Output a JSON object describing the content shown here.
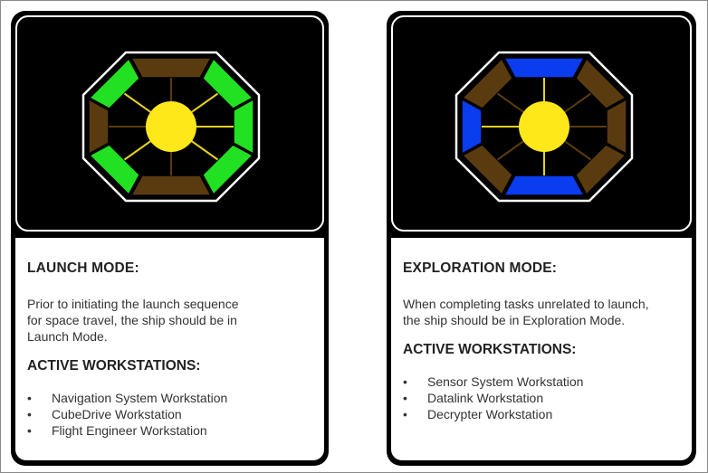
{
  "cards": [
    {
      "mode_title": "LAUNCH MODE:",
      "description": [
        "Prior to initiating the launch sequence",
        "for space travel, the ship should be in",
        "Launch Mode."
      ],
      "workstations_title": "ACTIVE WORKSTATIONS:",
      "workstations": [
        "Navigation System Workstation",
        "CubeDrive Workstation",
        "Flight Engineer Workstation"
      ],
      "segment_colors": {
        "top": "#5a3b10",
        "top_right": "#22e022",
        "right": "#22e022",
        "bottom_right": "#22e022",
        "bottom": "#5a3b10",
        "bottom_left": "#22e022",
        "left": "#5a3b10",
        "top_left": "#22e022"
      }
    },
    {
      "mode_title": "EXPLORATION MODE:",
      "description": [
        "When completing tasks unrelated to launch,",
        "the ship should be in Exploration Mode."
      ],
      "workstations_title": "ACTIVE WORKSTATIONS:",
      "workstations": [
        "Sensor System Workstation",
        "Datalink Workstation",
        "Decrypter Workstation"
      ],
      "segment_colors": {
        "top": "#0a3cf0",
        "top_right": "#5a3b10",
        "right": "#5a3b10",
        "bottom_right": "#5a3b10",
        "bottom": "#0a3cf0",
        "bottom_left": "#5a3b10",
        "left": "#0a3cf0",
        "top_left": "#5a3b10"
      }
    }
  ],
  "colors": {
    "core": "#ffe81a",
    "spoke_yellow": "#e6d21a",
    "spoke_brown": "#5a3b10",
    "inactive": "#5a3b10"
  },
  "bullet_char": "•"
}
